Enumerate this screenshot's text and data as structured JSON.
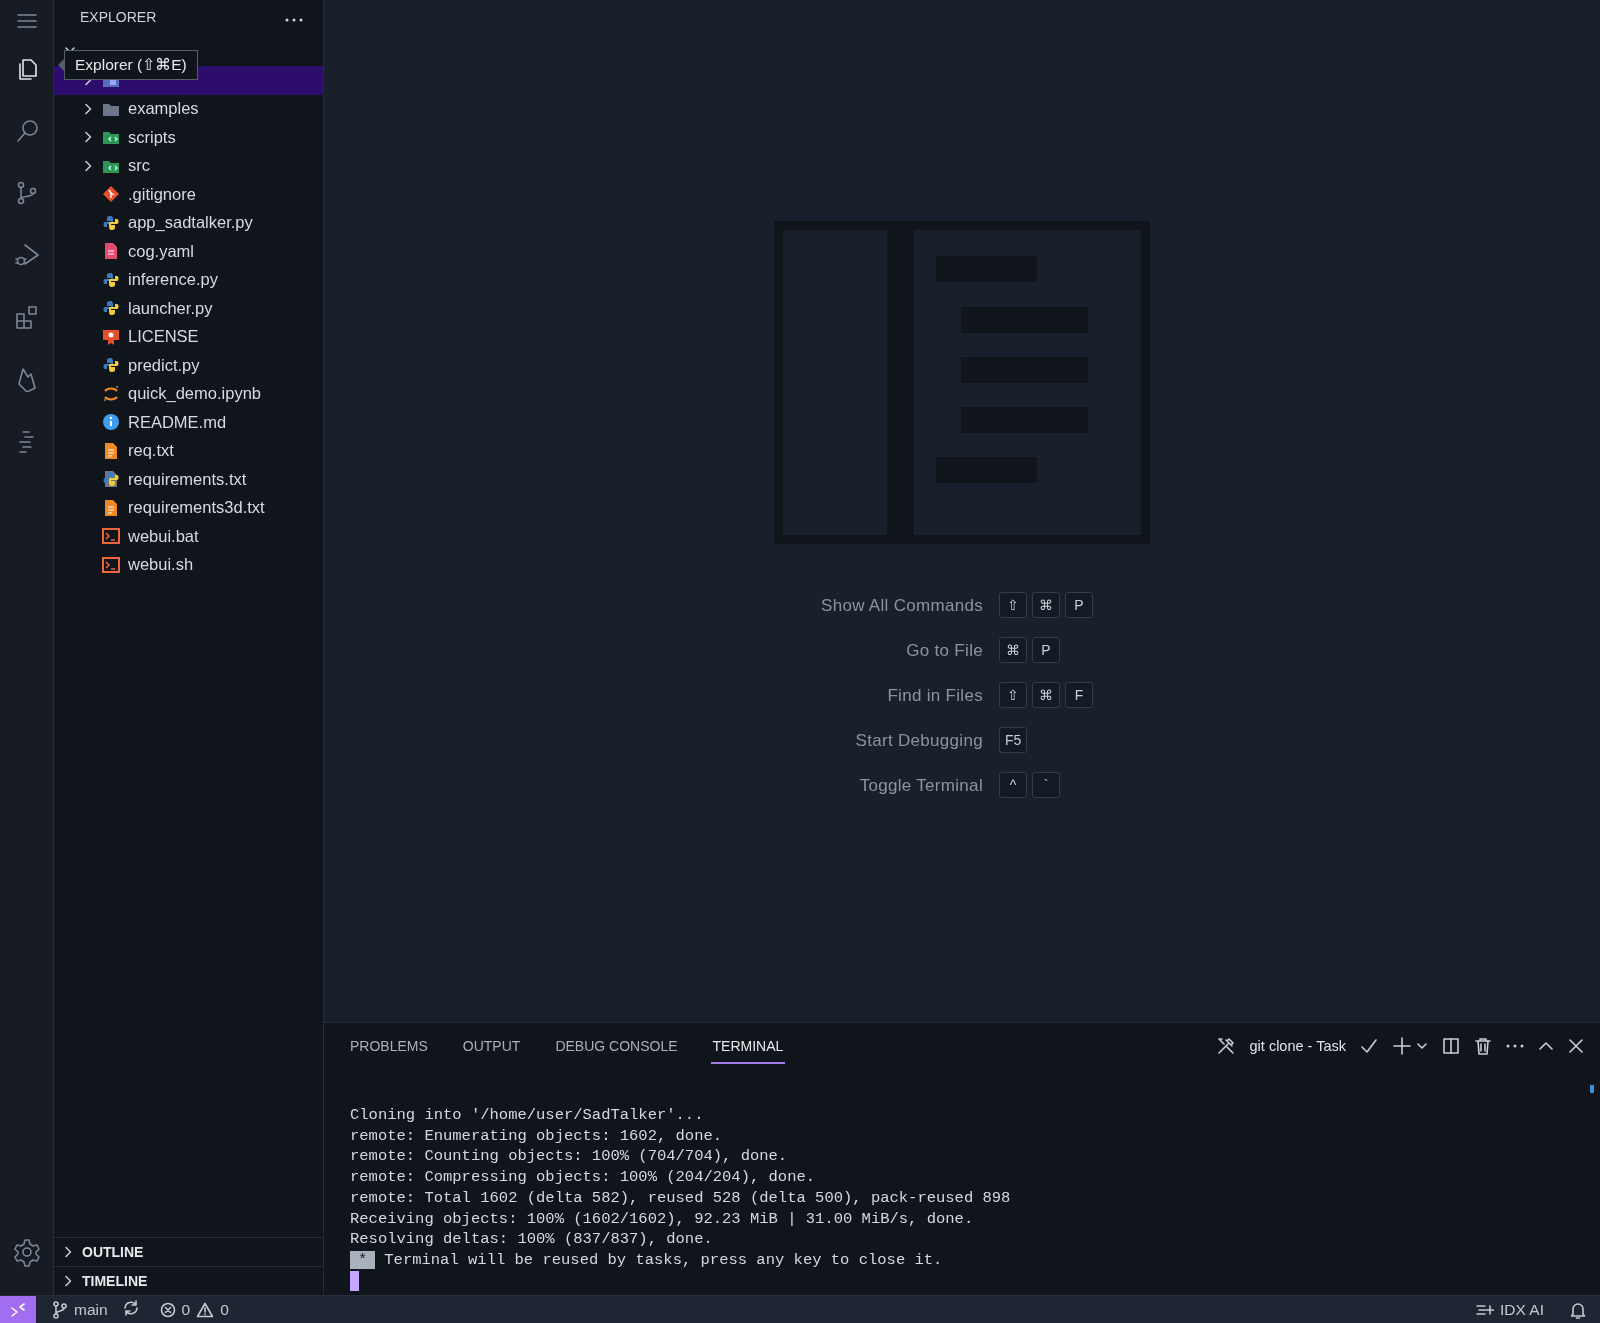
{
  "activity_bar": {
    "items": [
      {
        "selected": false
      },
      {
        "selected": true
      },
      {
        "selected": false
      },
      {
        "selected": false
      },
      {
        "selected": false
      },
      {
        "selected": false
      },
      {
        "selected": false
      },
      {
        "selected": false
      }
    ]
  },
  "tooltip": {
    "text": "Explorer (⇧⌘E)"
  },
  "sidebar": {
    "title": "EXPLORER",
    "folder": {
      "expanded": true
    },
    "tree": [
      {
        "kind": "docs",
        "expanded": false,
        "selected": true
      },
      {
        "label": "examples",
        "kind": "folder",
        "expanded": false,
        "selected": false
      },
      {
        "label": "scripts",
        "kind": "code",
        "expanded": false,
        "selected": false
      },
      {
        "label": "src",
        "kind": "code",
        "expanded": false,
        "selected": false
      },
      {
        "label": ".gitignore",
        "kind": "git",
        "selected": false
      },
      {
        "label": "app_sadtalker.py",
        "kind": "python",
        "selected": false
      },
      {
        "label": "cog.yaml",
        "kind": "yaml",
        "selected": false
      },
      {
        "label": "inference.py",
        "kind": "python",
        "selected": false
      },
      {
        "label": "launcher.py",
        "kind": "python",
        "selected": false
      },
      {
        "label": "LICENSE",
        "kind": "license",
        "selected": false
      },
      {
        "label": "predict.py",
        "kind": "python",
        "selected": false
      },
      {
        "label": "quick_demo.ipynb",
        "kind": "notebook",
        "selected": false
      },
      {
        "label": "README.md",
        "kind": "info",
        "selected": false
      },
      {
        "label": "req.txt",
        "kind": "text",
        "selected": false
      },
      {
        "label": "requirements.txt",
        "kind": "requirements",
        "selected": false
      },
      {
        "label": "requirements3d.txt",
        "kind": "text",
        "selected": false
      },
      {
        "label": "webui.bat",
        "kind": "shell",
        "selected": false
      },
      {
        "label": "webui.sh",
        "kind": "shell",
        "selected": false
      }
    ],
    "sections": [
      {
        "label": "OUTLINE",
        "expanded": false
      },
      {
        "label": "TIMELINE",
        "expanded": false
      }
    ]
  },
  "editor": {
    "shortcuts": [
      {
        "label": "Show All Commands",
        "keys": [
          "⇧",
          "⌘",
          "P"
        ]
      },
      {
        "label": "Go to File",
        "keys": [
          "⌘",
          "P"
        ]
      },
      {
        "label": "Find in Files",
        "keys": [
          "⇧",
          "⌘",
          "F"
        ]
      },
      {
        "label": "Start Debugging",
        "keys": [
          "F5"
        ]
      },
      {
        "label": "Toggle Terminal",
        "keys": [
          "^",
          "`"
        ]
      }
    ]
  },
  "panel": {
    "tabs": [
      {
        "label": "PROBLEMS",
        "selected": false
      },
      {
        "label": "OUTPUT",
        "selected": false
      },
      {
        "label": "DEBUG CONSOLE",
        "selected": false
      },
      {
        "label": "TERMINAL",
        "selected": true
      }
    ],
    "task": "git clone - Task",
    "lines": [
      "Cloning into '/home/user/SadTalker'...",
      "remote: Enumerating objects: 1602, done.",
      "remote: Counting objects: 100% (704/704), done.",
      "remote: Compressing objects: 100% (204/204), done.",
      "remote: Total 1602 (delta 582), reused 528 (delta 500), pack-reused 898",
      "Receiving objects: 100% (1602/1602), 92.23 MiB | 31.00 MiB/s, done.",
      "Resolving deltas: 100% (837/837), done."
    ],
    "badge": "*",
    "message": "Terminal will be reused by tasks, press any key to close it."
  },
  "status_bar": {
    "branch": "main",
    "errors": "0",
    "warnings": "0",
    "ai": "IDX AI"
  }
}
